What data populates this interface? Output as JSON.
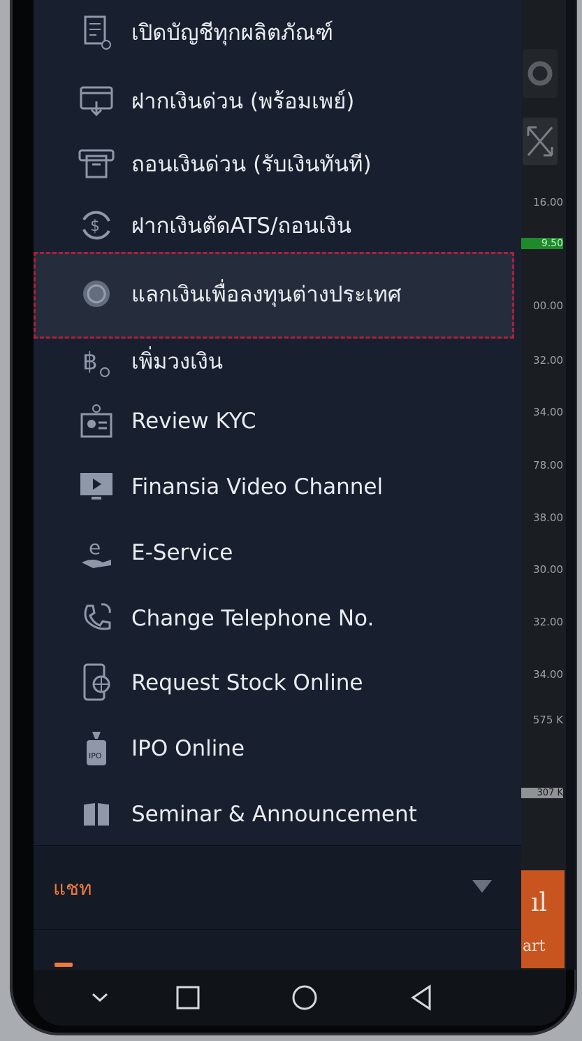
{
  "menu": {
    "items": [
      {
        "label": "เปิดบัญชีทุกผลิตภัณฑ์",
        "icon": "document-add-icon"
      },
      {
        "label": "ฝากเงินด่วน (พร้อมเพย์)",
        "icon": "card-deposit-icon"
      },
      {
        "label": "ถอนเงินด่วน (รับเงินทันที)",
        "icon": "atm-withdraw-icon"
      },
      {
        "label": "ฝากเงินตัดATS/ถอนเงิน",
        "icon": "dollar-cycle-icon"
      },
      {
        "label": "แลกเงินเพื่อลงทุนต่างประเทศ",
        "icon": "currency-exchange-icon"
      },
      {
        "label": "เพิ่มวงเงิน",
        "icon": "baht-add-icon"
      },
      {
        "label": "Review KYC",
        "icon": "id-card-icon"
      },
      {
        "label": "Finansia Video Channel",
        "icon": "video-play-icon"
      },
      {
        "label": "E-Service",
        "icon": "e-hand-icon"
      },
      {
        "label": "Change Telephone No.",
        "icon": "phone-change-icon"
      },
      {
        "label": "Request Stock Online",
        "icon": "mobile-globe-icon"
      },
      {
        "label": "IPO Online",
        "icon": "ipo-bag-icon"
      },
      {
        "label": "Seminar & Announcement",
        "icon": "book-icon"
      }
    ],
    "highlighted_index": 4
  },
  "chat": {
    "label": "แชท"
  },
  "background_app": {
    "prices": [
      "16.00",
      "9.50",
      "00.00",
      "32.00",
      "34.00",
      "78.00",
      "38.00",
      "30.00",
      "32.00",
      "34.00",
      "575 K",
      "307 K"
    ],
    "chart_button_label": "art"
  },
  "colors": {
    "drawer_bg": "#182030",
    "accent": "#f07a3a",
    "highlight_border": "#b01e3a",
    "price_up": "#1e8a2c"
  }
}
